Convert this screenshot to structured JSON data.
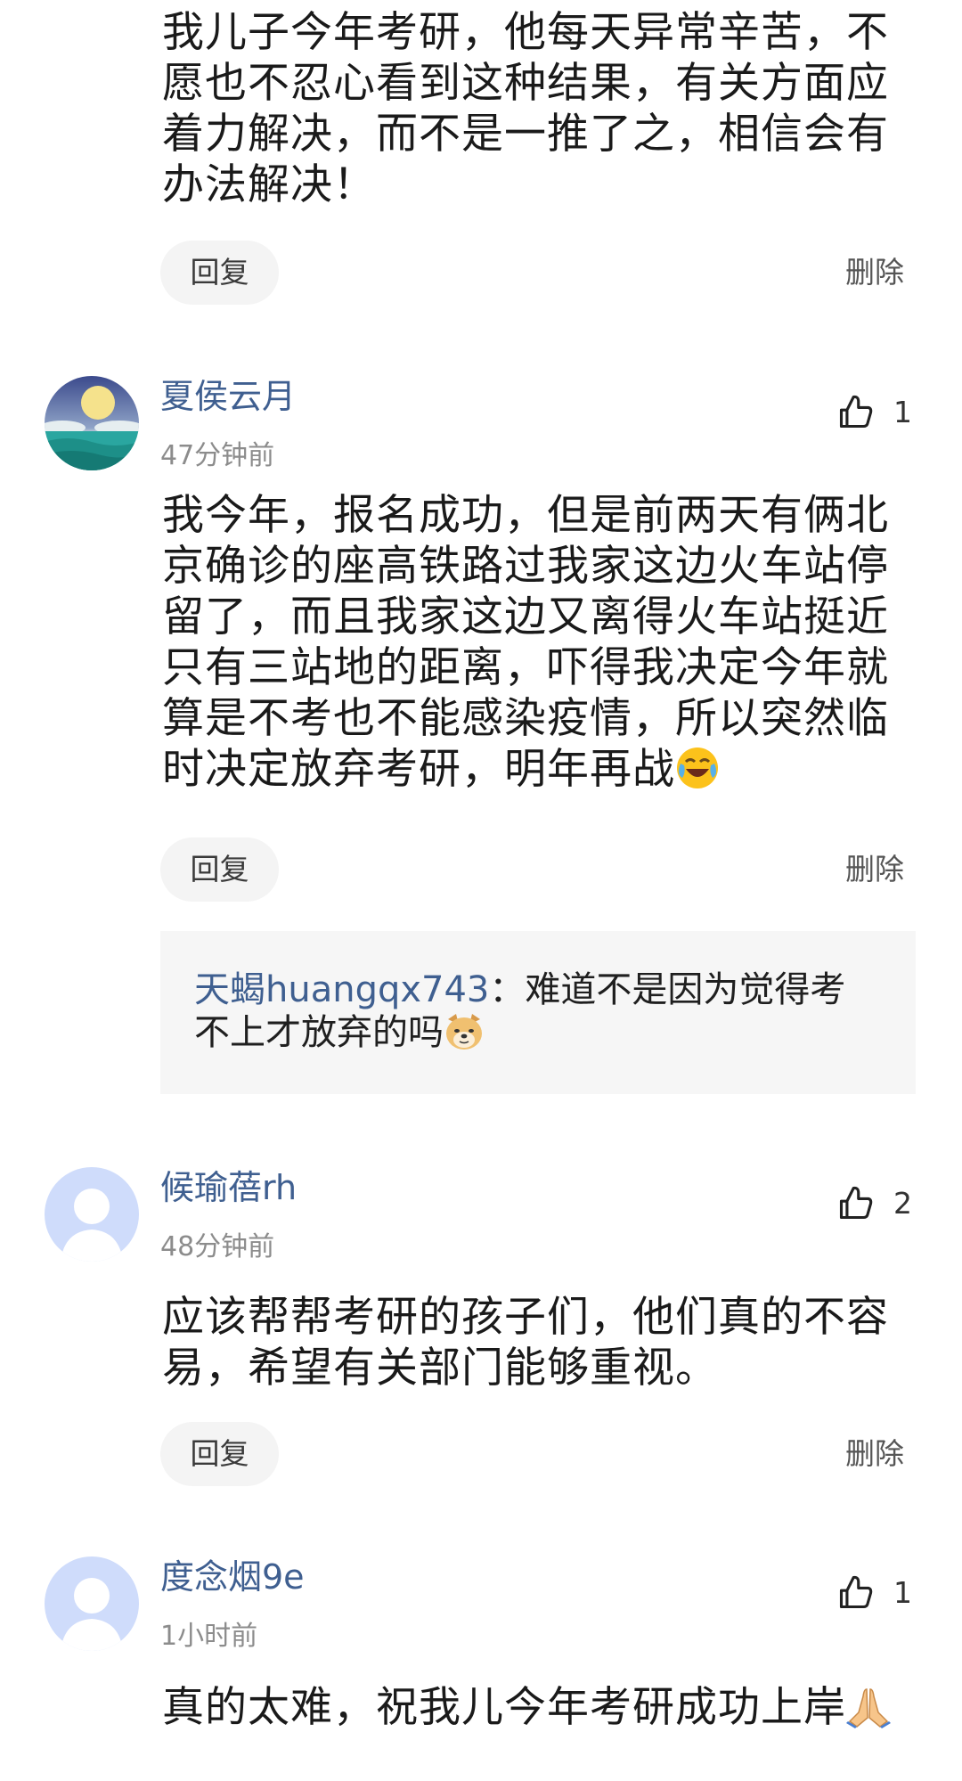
{
  "comments": [
    {
      "content": "我儿子今年考研，他每天异常辛苦，不愿也不忍心看到这种结果，有关方面应着力解决，而不是一推了之，相信会有办法解决！",
      "reply_label": "回复",
      "delete_label": "删除"
    },
    {
      "username": "夏侯云月",
      "time": "47分钟前",
      "likes": "1",
      "content": "我今年，报名成功，但是前两天有俩北京确诊的座高铁路过我家这边火车站停留了，而且我家这边又离得火车站挺近只有三站地的距离，吓得我决定今年就算是不考也不能感染疫情，所以突然临时决定放弃考研，明年再战",
      "content_emoji": "laughing-crying-emoji",
      "reply_label": "回复",
      "delete_label": "删除",
      "sub_reply": {
        "username": "天蝎huangqx743",
        "separator": "：",
        "text": "难道不是因为觉得考不上才放弃的吗",
        "emoji": "doge-emoji"
      }
    },
    {
      "username": "候瑜蓓rh",
      "time": "48分钟前",
      "likes": "2",
      "content": "应该帮帮考研的孩子们，他们真的不容易，希望有关部门能够重视。",
      "reply_label": "回复",
      "delete_label": "删除"
    },
    {
      "username": "度念烟9e",
      "time": "1小时前",
      "likes": "1",
      "content": "真的太难，祝我儿今年考研成功上岸",
      "content_emoji": "folded-hands-emoji"
    }
  ],
  "colors": {
    "username": "#3f5f90",
    "time": "#8c8c8c",
    "reply_bg": "#f4f4f4",
    "sub_reply_bg": "#f6f6f6"
  }
}
